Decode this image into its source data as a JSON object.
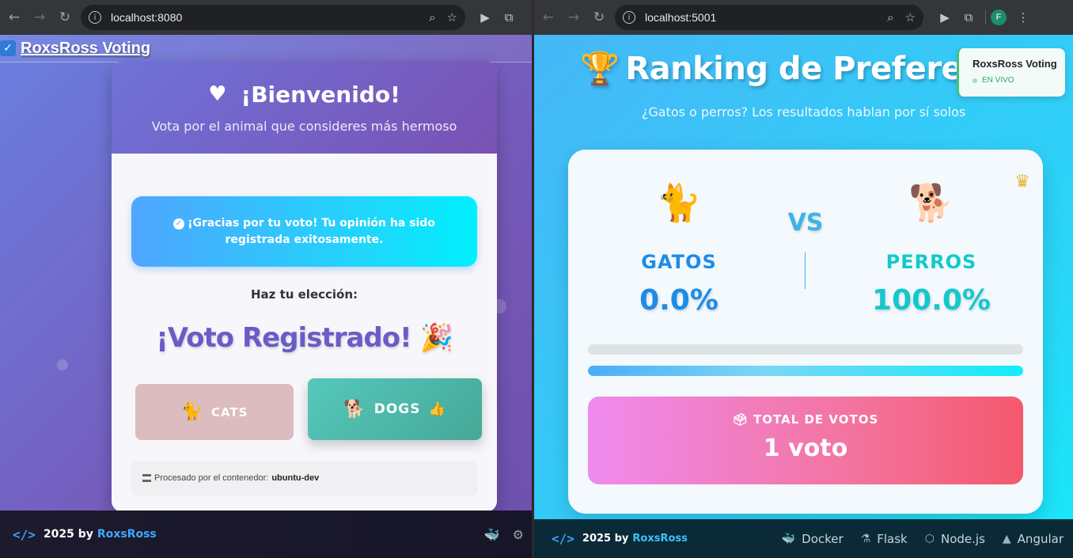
{
  "left_window": {
    "url": "localhost:8080",
    "nav_brand": "RoxsRoss Voting",
    "card": {
      "title": "¡Bienvenido!",
      "subtitle": "Vota por el animal que consideres más hermoso",
      "alert": "¡Gracias por tu voto! Tu opinión ha sido registrada exitosamente.",
      "choice_label": "Haz tu elección:",
      "voted_text": "¡Voto Registrado! 🎉",
      "cats_button": "CATS",
      "dogs_button": "DOGS",
      "processed_label": "Procesado por el contenedor:",
      "container_name": "ubuntu-dev"
    },
    "footer": {
      "year_by": "2025 by",
      "brand": "RoxsRoss"
    }
  },
  "right_window": {
    "url": "localhost:5001",
    "profile_initial": "F",
    "title": "Ranking de Preferen",
    "subtitle": "¿Gatos o perros? Los resultados hablan por sí solos",
    "live_badge": {
      "title": "RoxsRoss Voting",
      "status": "EN VIVO"
    },
    "vs": "VS",
    "cats": {
      "name": "GATOS",
      "percent": "0.0%",
      "fraction": 0.0
    },
    "dogs": {
      "name": "PERROS",
      "percent": "100.0%",
      "fraction": 1.0
    },
    "total": {
      "label": "TOTAL DE VOTOS",
      "value": "1 voto"
    },
    "footer": {
      "year_by": "2025 by",
      "brand": "RoxsRoss",
      "tech": [
        "Docker",
        "Flask",
        "Node.js",
        "Angular"
      ]
    }
  },
  "colors": {
    "cats": "#1e8ce8",
    "dogs": "#14c8cc",
    "accent": "#3ea8ff"
  }
}
